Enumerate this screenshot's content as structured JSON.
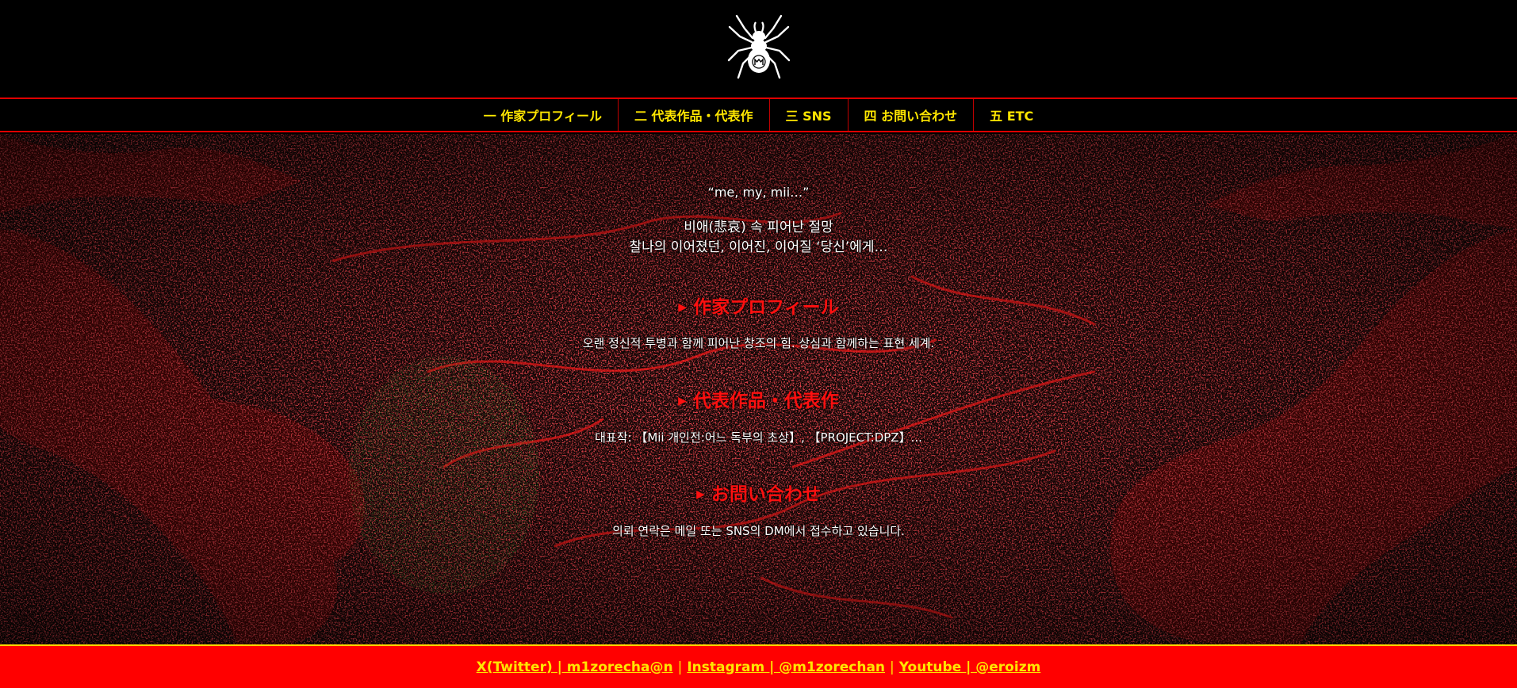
{
  "logo": {
    "icon": "spider-logo-icon",
    "mark": "m"
  },
  "nav": {
    "items": [
      {
        "label": "一 作家プロフィール"
      },
      {
        "label": "二 代表作品・代表作"
      },
      {
        "label": "三 SNS"
      },
      {
        "label": "四 お問い合わせ"
      },
      {
        "label": "五 ETC"
      }
    ]
  },
  "main": {
    "tagline": "“me, my, mii…”",
    "intro_line1": "비애(悲哀) 속 피어난 절망",
    "intro_line2": "찰나의 이어졌던, 이어진, 이어질 ‘당신’에게…",
    "sections": [
      {
        "title": "作家プロフィール",
        "text": "오랜 정신적 투병과 함께 피어난 창조의 힘. 상심과 함께하는 표현 세계."
      },
      {
        "title": "代表作品・代表作",
        "text": "대표작: 【Mii 개인전:어느 독부의 초상】, 【PROJECT:DPZ】..."
      },
      {
        "title": "お問い合わせ",
        "text": "의뢰 연락은 메일 또는 SNS의 DM에서 접수하고 있습니다."
      }
    ]
  },
  "footer": {
    "links": [
      {
        "label": "X(Twitter) | m1zorecha@n"
      },
      {
        "label": "Instagram | @m1zorechan"
      },
      {
        "label": "Youtube | @eroizm"
      }
    ],
    "separator": "|"
  },
  "colors": {
    "background": "#000000",
    "accent_red": "#ff0000",
    "nav_text": "#ffe600",
    "section_title": "#ff1010"
  }
}
